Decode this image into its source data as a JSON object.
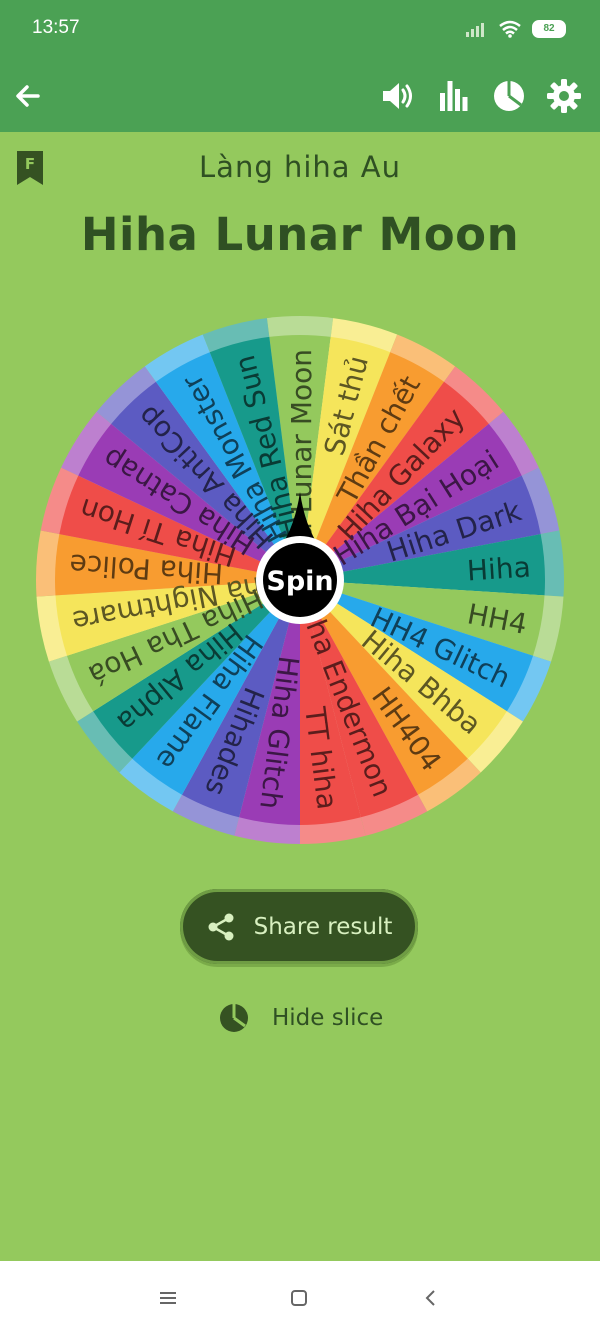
{
  "status_bar": {
    "time": "13:57",
    "battery": "82"
  },
  "app_bar": {
    "icons": [
      "arrow-left-icon",
      "volume-icon",
      "bar-chart-icon",
      "pie-chart-icon",
      "gear-icon"
    ],
    "color": "#4ba154"
  },
  "header": {
    "bookmark_letter": "F",
    "subtitle": "Làng hiha Au",
    "title": "Hiha Lunar Moon"
  },
  "wheel": {
    "center_label": "Spin",
    "slices": [
      {
        "label": "Hiha Lunar Moon",
        "color": "#94c95d"
      },
      {
        "label": "Sát thủ",
        "color": "#f5e55b"
      },
      {
        "label": "Thần chết",
        "color": "#f89c30"
      },
      {
        "label": "Hiha Galaxy",
        "color": "#ef4d49"
      },
      {
        "label": "Hiha Bại Hoại",
        "color": "#9a3cb5"
      },
      {
        "label": "Hiha Dark",
        "color": "#5c5bc2"
      },
      {
        "label": "Hiha",
        "color": "#179a8b"
      },
      {
        "label": "HH4",
        "color": "#94c95d"
      },
      {
        "label": "HH4 Glitch",
        "color": "#27a9eb"
      },
      {
        "label": "Hiha Bhba",
        "color": "#f5e55b"
      },
      {
        "label": "HH404",
        "color": "#f89c30"
      },
      {
        "label": "Hiha Endermon",
        "color": "#ef4d49"
      },
      {
        "label": "TT hiha",
        "color": "#ef4d49"
      },
      {
        "label": "Hiha Glitch",
        "color": "#9a3cb5"
      },
      {
        "label": "Hihades",
        "color": "#5c5bc2"
      },
      {
        "label": "Hiha Flame",
        "color": "#27a9eb"
      },
      {
        "label": "Hiha Alpha",
        "color": "#179a8b"
      },
      {
        "label": "Hiha Tha Hoá",
        "color": "#94c95d"
      },
      {
        "label": "Hiha Nightmare",
        "color": "#f5e55b"
      },
      {
        "label": "Hiha Police",
        "color": "#f89c30"
      },
      {
        "label": "Hiha Tí Hon",
        "color": "#ef4d49"
      },
      {
        "label": "Hiha Catnap",
        "color": "#9a3cb5"
      },
      {
        "label": "Hiha AntiCop",
        "color": "#5c5bc2"
      },
      {
        "label": "Hiha Monster",
        "color": "#27a9eb"
      },
      {
        "label": "Hiha Red Sun",
        "color": "#179a8b"
      }
    ]
  },
  "actions": {
    "share_label": "Share result",
    "hide_label": "Hide slice"
  }
}
